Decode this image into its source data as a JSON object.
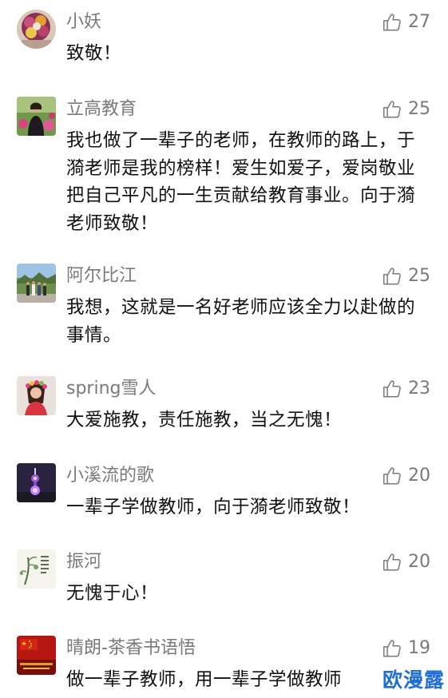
{
  "comments": [
    {
      "name": "小妖",
      "likes": "27",
      "text": "致敬！",
      "avatar": "flower-bouquet-avatar"
    },
    {
      "name": "立高教育",
      "likes": "25",
      "text": "我也做了一辈子的老师，在教师的路上，于漪老师是我的榜样！爱生如爱子，爱岗敬业把自己平凡的一生贡献给教育事业。向于漪老师致敬！",
      "avatar": "woman-flowers-avatar"
    },
    {
      "name": "阿尔比江",
      "likes": "25",
      "text": "我想，这就是一名好老师应该全力以赴做的事情。",
      "avatar": "group-photo-avatar"
    },
    {
      "name": "spring雪人",
      "likes": "23",
      "text": "大爱施教，责任施教，当之无愧！",
      "avatar": "girl-flower-crown-avatar"
    },
    {
      "name": "小溪流的歌",
      "likes": "20",
      "text": "一辈子学做教师，向于漪老师致敬！",
      "avatar": "night-tower-avatar"
    },
    {
      "name": "振河",
      "likes": "20",
      "text": "无愧于心！",
      "avatar": "ink-painting-avatar"
    },
    {
      "name": "晴朗-茶香书语悟",
      "likes": "19",
      "text": "做一辈子教师，用一辈子学做教师",
      "avatar": "red-flag-avatar"
    }
  ],
  "watermark": "欧漫露",
  "colors": {
    "name_gray": "#7a7a7a",
    "text_black": "#111111",
    "watermark_blue": "#1f6fd8"
  },
  "icons": {
    "like": "thumbs-up-outline-icon"
  }
}
